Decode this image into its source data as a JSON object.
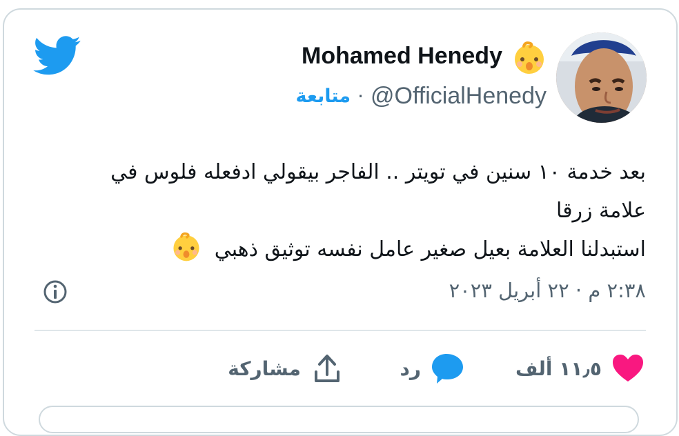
{
  "user": {
    "name": "Mohamed Henedy",
    "badge_icon": "baby-emoji",
    "handle": "@OfficialHenedy",
    "separator": "·",
    "follow_label": "متابعة"
  },
  "tweet": {
    "lines": [
      "بعد خدمة ١٠ سنين في تويتر .. الفاجر بيقولي ادفعله فلوس في",
      "علامة زرقا",
      "استبدلنا العلامة بعيل صغير عامل نفسه توثيق ذهبي"
    ],
    "timestamp": "٢:٣٨ م · ٢٢ أبريل ٢٠٢٣"
  },
  "actions": {
    "like_count": "١١٫٥ ألف",
    "reply_label": "رد",
    "share_label": "مشاركة"
  },
  "colors": {
    "accent": "#1d9bf0",
    "like": "#f91880",
    "muted": "#536471",
    "border": "#cfd9de"
  }
}
